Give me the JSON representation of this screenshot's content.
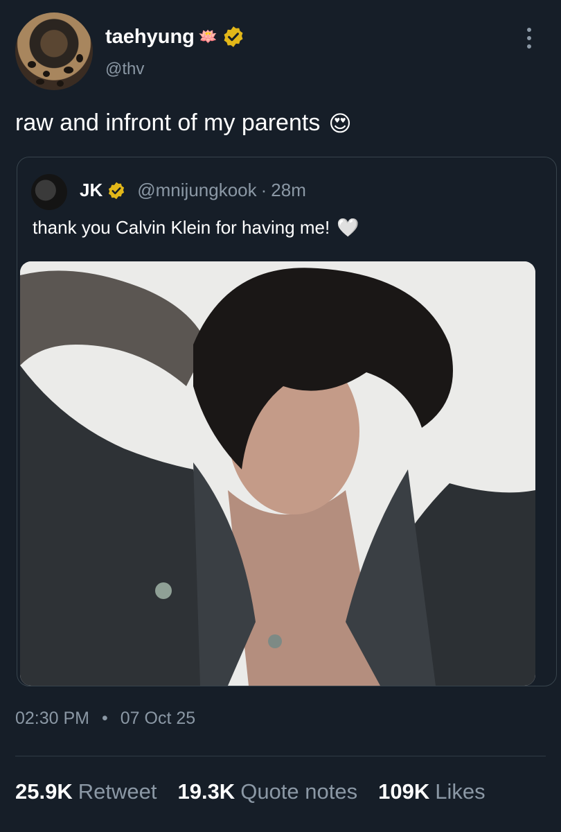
{
  "author": {
    "display_name": "taehyung",
    "name_emoji": "🪷",
    "handle": "@thv",
    "verified_badge_color": "#e2b719"
  },
  "tweet": {
    "text": "raw and infront of my parents",
    "emoji": "😍"
  },
  "quoted": {
    "name": "JK",
    "handle": "@mnijungkook",
    "separator": "·",
    "time": "28m",
    "text": "thank you Calvin Klein for having me!",
    "emoji": "🤍",
    "media_icon": "photo"
  },
  "meta": {
    "time": "02:30 PM",
    "separator": "•",
    "date": "07 Oct 25"
  },
  "stats": {
    "retweets": {
      "count": "25.9K",
      "label": "Retweet"
    },
    "quotes": {
      "count": "19.3K",
      "label": "Quote notes"
    },
    "likes": {
      "count": "109K",
      "label": "Likes"
    }
  },
  "colors": {
    "background": "#161e28",
    "secondary_text": "#8b98a5",
    "border": "#38444d"
  }
}
